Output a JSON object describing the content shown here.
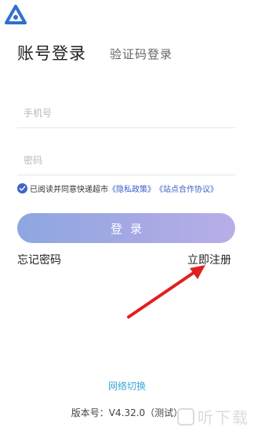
{
  "tabs": {
    "account_login": "账号登录",
    "sms_login": "验证码登录"
  },
  "form": {
    "phone_placeholder": "手机号",
    "password_placeholder": "密码"
  },
  "agreement": {
    "checked": true,
    "prefix": "已阅读并同意快递超市",
    "privacy_link": "《隐私政策》",
    "site_link": "《站点合作协议》"
  },
  "actions": {
    "login_label": "登录",
    "forgot_password": "忘记密码",
    "register_now": "立即注册"
  },
  "footer": {
    "network_switch": "网络切换",
    "version": "版本号：V4.32.0（测试）"
  },
  "watermark": {
    "text": "听下载"
  },
  "colors": {
    "accent": "#3f63c8",
    "link": "#3a5fc8",
    "network_link": "#3aa6d8",
    "arrow": "#e02020"
  }
}
